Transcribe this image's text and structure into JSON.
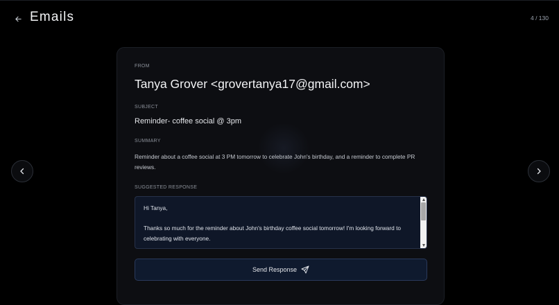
{
  "header": {
    "title": "Emails",
    "counter": "4 / 130"
  },
  "email": {
    "from_label": "FROM",
    "from": "Tanya Grover <grovertanya17@gmail.com>",
    "subject_label": "SUBJECT",
    "subject": "Reminder- coffee social @ 3pm",
    "summary_label": "SUMMARY",
    "summary": "Reminder about a coffee social at 3 PM tomorrow to celebrate John's birthday, and a reminder to complete PR reviews.",
    "suggested_label": "SUGGESTED RESPONSE",
    "suggested_response": "Hi Tanya,\n\nThanks so much for the reminder about John's birthday coffee social tomorrow! I'm looking forward to celebrating with everyone."
  },
  "actions": {
    "send_label": "Send Response"
  },
  "icons": {
    "back": "arrow-left-icon",
    "prev": "chevron-left-icon",
    "next": "chevron-right-icon",
    "send": "send-icon"
  },
  "colors": {
    "background": "#000000",
    "card": "#0d0e12",
    "response_box": "#0f1728",
    "button": "#0f1a2e",
    "text": "#f3f4f6",
    "muted": "#8b9099"
  }
}
